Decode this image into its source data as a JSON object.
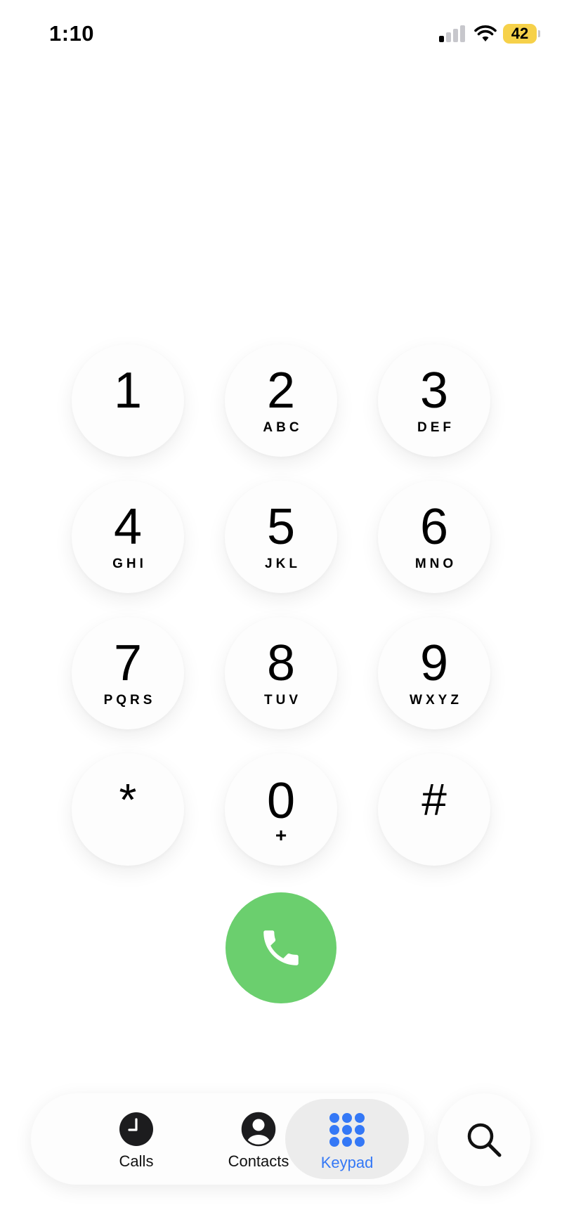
{
  "status_bar": {
    "time": "1:10",
    "battery_level": "42",
    "battery_color": "#f6d14a",
    "signal_bars_active": 1,
    "signal_bars_total": 4
  },
  "keypad": {
    "keys": [
      {
        "digit": "1",
        "letters": ""
      },
      {
        "digit": "2",
        "letters": "ABC"
      },
      {
        "digit": "3",
        "letters": "DEF"
      },
      {
        "digit": "4",
        "letters": "GHI"
      },
      {
        "digit": "5",
        "letters": "JKL"
      },
      {
        "digit": "6",
        "letters": "MNO"
      },
      {
        "digit": "7",
        "letters": "PQRS"
      },
      {
        "digit": "8",
        "letters": "TUV"
      },
      {
        "digit": "9",
        "letters": "WXYZ"
      },
      {
        "digit": "*",
        "letters": ""
      },
      {
        "digit": "0",
        "letters": "+"
      },
      {
        "digit": "#",
        "letters": ""
      }
    ]
  },
  "call_button": {
    "icon": "phone-icon",
    "color": "#6bcf6e"
  },
  "tab_bar": {
    "tabs": [
      {
        "label": "Calls",
        "icon": "clock-icon",
        "active": false
      },
      {
        "label": "Contacts",
        "icon": "person-circle-icon",
        "active": false
      },
      {
        "label": "Keypad",
        "icon": "keypad-grid-icon",
        "active": true
      }
    ],
    "active_color": "#3478f6"
  },
  "search_button": {
    "icon": "search-icon"
  }
}
